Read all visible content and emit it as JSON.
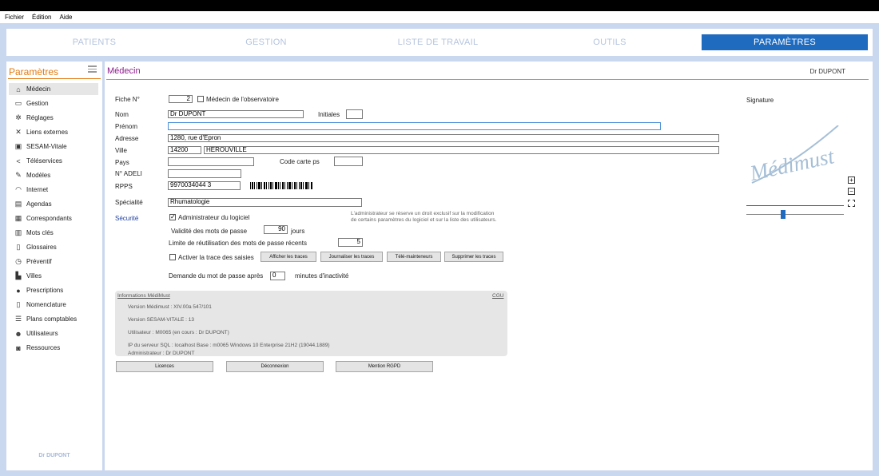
{
  "menu": [
    "Fichier",
    "Édition",
    "Aide"
  ],
  "nav": {
    "tabs": [
      {
        "label": "PATIENTS",
        "active": false
      },
      {
        "label": "GESTION",
        "active": false
      },
      {
        "label": "LISTE DE TRAVAIL",
        "active": false
      },
      {
        "label": "OUTILS",
        "active": false
      },
      {
        "label": "PARAMÈTRES",
        "active": true
      }
    ],
    "active_color": "#1f6bbf"
  },
  "sidebar": {
    "title": "Paramètres",
    "title_color": "#e27a12",
    "user": "Dr DUPONT",
    "items": [
      {
        "label": "Médecin",
        "icon": "home-icon",
        "active": true
      },
      {
        "label": "Gestion",
        "icon": "inbox-icon"
      },
      {
        "label": "Réglages",
        "icon": "gears-icon"
      },
      {
        "label": "Liens externes",
        "icon": "network-icon"
      },
      {
        "label": "SESAM-Vitale",
        "icon": "card-icon"
      },
      {
        "label": "Téléservices",
        "icon": "share-icon"
      },
      {
        "label": "Modèles",
        "icon": "edit-icon"
      },
      {
        "label": "Internet",
        "icon": "wifi-icon"
      },
      {
        "label": "Agendas",
        "icon": "calendar-icon"
      },
      {
        "label": "Correspondants",
        "icon": "contacts-icon"
      },
      {
        "label": "Mots clés",
        "icon": "chart-icon"
      },
      {
        "label": "Glossaires",
        "icon": "book-icon"
      },
      {
        "label": "Préventif",
        "icon": "clock-icon"
      },
      {
        "label": "Villes",
        "icon": "city-icon"
      },
      {
        "label": "Prescriptions",
        "icon": "pills-icon"
      },
      {
        "label": "Nomenclature",
        "icon": "document-icon"
      },
      {
        "label": "Plans comptables",
        "icon": "list-icon"
      },
      {
        "label": "Utilisateurs",
        "icon": "users-icon"
      },
      {
        "label": "Ressources",
        "icon": "car-icon"
      }
    ]
  },
  "main": {
    "title": "Médecin",
    "title_color": "#8b1a8b",
    "user": "Dr DUPONT",
    "form": {
      "fiche_label": "Fiche N°",
      "fiche_value": "2",
      "observatoire_label": "Médecin de l'observatoire",
      "nom_label": "Nom",
      "nom_value": "Dr DUPONT",
      "initiales_label": "Initiales",
      "initiales_value": "",
      "prenom_label": "Prénom",
      "prenom_value": "",
      "adresse_label": "Adresse",
      "adresse_value": "1280, rue d'Epron",
      "ville_label": "Ville",
      "cp_value": "14200",
      "ville_value": "HEROUVILLE",
      "pays_label": "Pays",
      "pays_value": "",
      "code_carte_label": "Code carte ps",
      "code_carte_value": "",
      "adeli_label": "N° ADELI",
      "adeli_value": "",
      "rpps_label": "RPPS",
      "rpps_value": "9970034044 3",
      "specialite_label": "Spécialité",
      "specialite_value": "Rhumatologie"
    },
    "security": {
      "section_label": "Sécurité",
      "admin_label": "Administrateur du logiciel",
      "admin_checked": true,
      "note": "L'administrateur se réserve un droit exclusif sur la modification de certains paramètres du logiciel et sur la liste des utilisateurs.",
      "validity_label": "Validité des mots de passe",
      "validity_value": "90",
      "validity_unit": "jours",
      "reuse_label": "Limite de réutilisation des mots de passe récents",
      "reuse_value": "5",
      "trace_label": "Activer la trace des saisies",
      "buttons": [
        "Afficher les traces",
        "Journaliser les traces",
        "Télé-mainteneurs",
        "Supprimer les traces"
      ],
      "inactivity_label": "Demande du mot de passe après",
      "inactivity_value": "0",
      "inactivity_unit": "minutes d'inactivité"
    },
    "info": {
      "title": "Informations MédiMust",
      "cgu": "CGU",
      "lines": [
        "Version Médimust : XIV.00a    547/101",
        "Version SESAM-VITALE : 13",
        "Utilisateur : M0065   (en cours : Dr DUPONT)",
        "IP du serveur SQL : localhost   Base : m0065      Windows 10 Enterprise 21H2 (19044.1889)",
        "Administrateur : Dr DUPONT"
      ]
    },
    "bottom_buttons": [
      "Licences",
      "Déconnexion",
      "Mention RGPD"
    ],
    "signature": {
      "label": "Signature",
      "logo_text": "Médimust",
      "zoom_level": 0.38
    }
  }
}
